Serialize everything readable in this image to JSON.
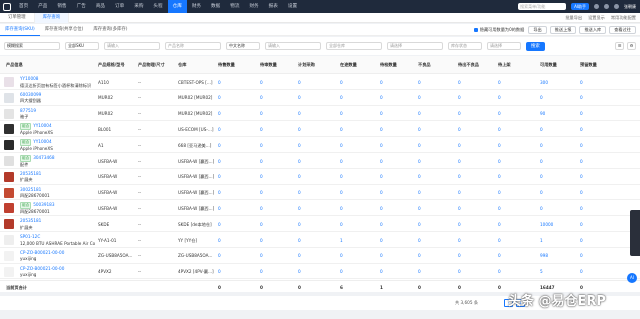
{
  "nav": {
    "items": [
      "首页",
      "产品",
      "销售",
      "广告",
      "商品",
      "订单",
      "采购",
      "头程",
      "仓库",
      "财务",
      "数据",
      "物流",
      "财务",
      "报表",
      "设置"
    ],
    "active_index": 8,
    "search_placeholder": "搜索菜单/功能",
    "ai_label": "AI助手",
    "user": "张朝康"
  },
  "tabs": {
    "items": [
      "订单管理",
      "库存查询"
    ],
    "active_index": 1,
    "right": [
      "批量导出",
      "设置显示",
      "常用功能配置"
    ]
  },
  "subtabs": {
    "items": [
      "库存查询(SKU)",
      "库存查询(共享仓位)",
      "库存查询(多库存)"
    ],
    "active_index": 0,
    "checkbox_label": "隐藏可用数量为0的数据",
    "buttons": [
      "导出",
      "推送上报",
      "推送入库",
      "查看过往"
    ]
  },
  "filters": {
    "fields": [
      {
        "value": "模糊搜索",
        "dark": true
      },
      {
        "value": "全部SKU",
        "dark": true
      },
      {
        "value": "请输入",
        "dark": false
      },
      {
        "value": "产品名称",
        "dark": false
      },
      {
        "value": "中文名称",
        "dark": true
      },
      {
        "value": "请输入",
        "dark": false
      },
      {
        "value": "全部仓库",
        "dark": false
      },
      {
        "value": "请选择",
        "dark": false
      },
      {
        "value": "库存状态",
        "dark": false
      },
      {
        "value": "请选择",
        "dark": false
      }
    ],
    "search_label": "搜索"
  },
  "table": {
    "columns": [
      "产品信息",
      "产品规格/型号",
      "产品物理/尺寸",
      "仓库",
      "待售数量",
      "待审数量",
      "计划采购",
      "在途数量",
      "待检数量",
      "不良品",
      "待出不良品",
      "待上架",
      "可用数量",
      "预留数量"
    ],
    "rows": [
      {
        "line1": "YY10008",
        "line2": "德汉达折页加有标签小酒杯和清除标识",
        "tag": "",
        "spec": "A110",
        "dim": "--",
        "wh": "CBTEST-OPS [...]",
        "v": [
          "0",
          "0",
          "0",
          "0",
          "0",
          "0",
          "0",
          "0",
          "300",
          "0"
        ],
        "thumb": "#e9e0e8"
      },
      {
        "line1": "60030099",
        "line2": "四大搜刮器",
        "tag": "",
        "spec": "MUR02",
        "dim": "--",
        "wh": "MUR02 [MUR02]",
        "v": [
          "0",
          "0",
          "0",
          "0",
          "0",
          "0",
          "0",
          "0",
          "0",
          "0"
        ],
        "thumb": "#dfe3e8"
      },
      {
        "line1": "877519",
        "line2": "袖子",
        "tag": "",
        "spec": "MUR02",
        "dim": "--",
        "wh": "MUR02 [MUR02]",
        "v": [
          "0",
          "0",
          "0",
          "0",
          "0",
          "0",
          "0",
          "0",
          "90",
          "0"
        ],
        "thumb": "#e4e4e4"
      },
      {
        "line1": "YY10004",
        "line2": "Apple iPhoneXS",
        "tag": "组合",
        "spec": "BL001",
        "dim": "--",
        "wh": "US-ECOM [US-...]",
        "v": [
          "0",
          "0",
          "0",
          "0",
          "0",
          "0",
          "0",
          "0",
          "0",
          "0"
        ],
        "thumb": "#303030"
      },
      {
        "line1": "YY10004",
        "line2": "Apple iPhoneXS",
        "tag": "组合",
        "spec": "A1",
        "dim": "--",
        "wh": "668 [亚马逊美...]",
        "v": [
          "0",
          "0",
          "0",
          "0",
          "0",
          "0",
          "0",
          "0",
          "0",
          "0"
        ],
        "thumb": "#2a2a2a"
      },
      {
        "line1": "30473468",
        "line2": "配件",
        "tag": "组合",
        "spec": "USFBA-W",
        "dim": "--",
        "wh": "USFBA-W [赢西...]",
        "v": [
          "0",
          "0",
          "0",
          "0",
          "0",
          "0",
          "0",
          "0",
          "0",
          "0"
        ],
        "thumb": "#e0e0e0"
      },
      {
        "line1": "20535181",
        "line2": "扩展夹",
        "tag": "",
        "spec": "USFBA-W",
        "dim": "--",
        "wh": "USFBA-W [赢西...]",
        "v": [
          "0",
          "0",
          "0",
          "0",
          "0",
          "0",
          "0",
          "0",
          "0",
          "0"
        ],
        "thumb": "#b33a2a"
      },
      {
        "line1": "30025181",
        "line2": "四配28670001",
        "tag": "",
        "spec": "USFBA-W",
        "dim": "--",
        "wh": "USFBA-W [赢西...]",
        "v": [
          "0",
          "0",
          "0",
          "0",
          "0",
          "0",
          "0",
          "0",
          "0",
          "0"
        ],
        "thumb": "#c44a32"
      },
      {
        "line1": "50039183",
        "line2": "四配28670001",
        "tag": "组合",
        "spec": "USFBA-W",
        "dim": "--",
        "wh": "USFBA-W [赢西...]",
        "v": [
          "0",
          "0",
          "0",
          "0",
          "0",
          "0",
          "0",
          "0",
          "0",
          "0"
        ],
        "thumb": "#c04030"
      },
      {
        "line1": "20535181",
        "line2": "扩展夹",
        "tag": "",
        "spec": "SKDE",
        "dim": "--",
        "wh": "SKDE [de本地仓]",
        "v": [
          "0",
          "0",
          "0",
          "0",
          "0",
          "0",
          "0",
          "0",
          "10000",
          "0"
        ],
        "thumb": "#b33a2a"
      },
      {
        "line1": "SP01-12C",
        "line2": "12,000 BTU ASHRAE Portable Air Co",
        "tag": "",
        "spec": "YY-A1-01",
        "dim": "--",
        "wh": "YY [YY仓]",
        "v": [
          "0",
          "0",
          "0",
          "1",
          "0",
          "0",
          "0",
          "0",
          "1",
          "0"
        ],
        "thumb": "#eeeeee"
      },
      {
        "line1": "CP-ZO-B00021-00-00",
        "line2": "yuxijing",
        "tag": "",
        "spec": "ZG-USB8A5OA...",
        "dim": "--",
        "wh": "ZG-USB8A5OA...",
        "v": [
          "0",
          "0",
          "0",
          "0",
          "0",
          "0",
          "0",
          "0",
          "998",
          "0"
        ],
        "thumb": "#f2f2f2"
      },
      {
        "line1": "CP-ZO-B00021-00-00",
        "line2": "yuxijing",
        "tag": "",
        "spec": "4PVX2",
        "dim": "--",
        "wh": "4PVX2 [4PV-赢...]",
        "v": [
          "0",
          "0",
          "0",
          "0",
          "0",
          "0",
          "0",
          "0",
          "5",
          "0"
        ],
        "thumb": "#f2f2f2"
      }
    ],
    "summary_label": "当前页合计",
    "summary": [
      "0",
      "0",
      "0",
      "6",
      "1",
      "0",
      "0",
      "0",
      "16447",
      "0"
    ]
  },
  "pager": {
    "total": "共 3,605 条",
    "current": "1"
  },
  "watermark": "头条 @易仓ERP",
  "colors": {
    "primary": "#1677ff",
    "nav_bg": "#1f2a3c"
  }
}
